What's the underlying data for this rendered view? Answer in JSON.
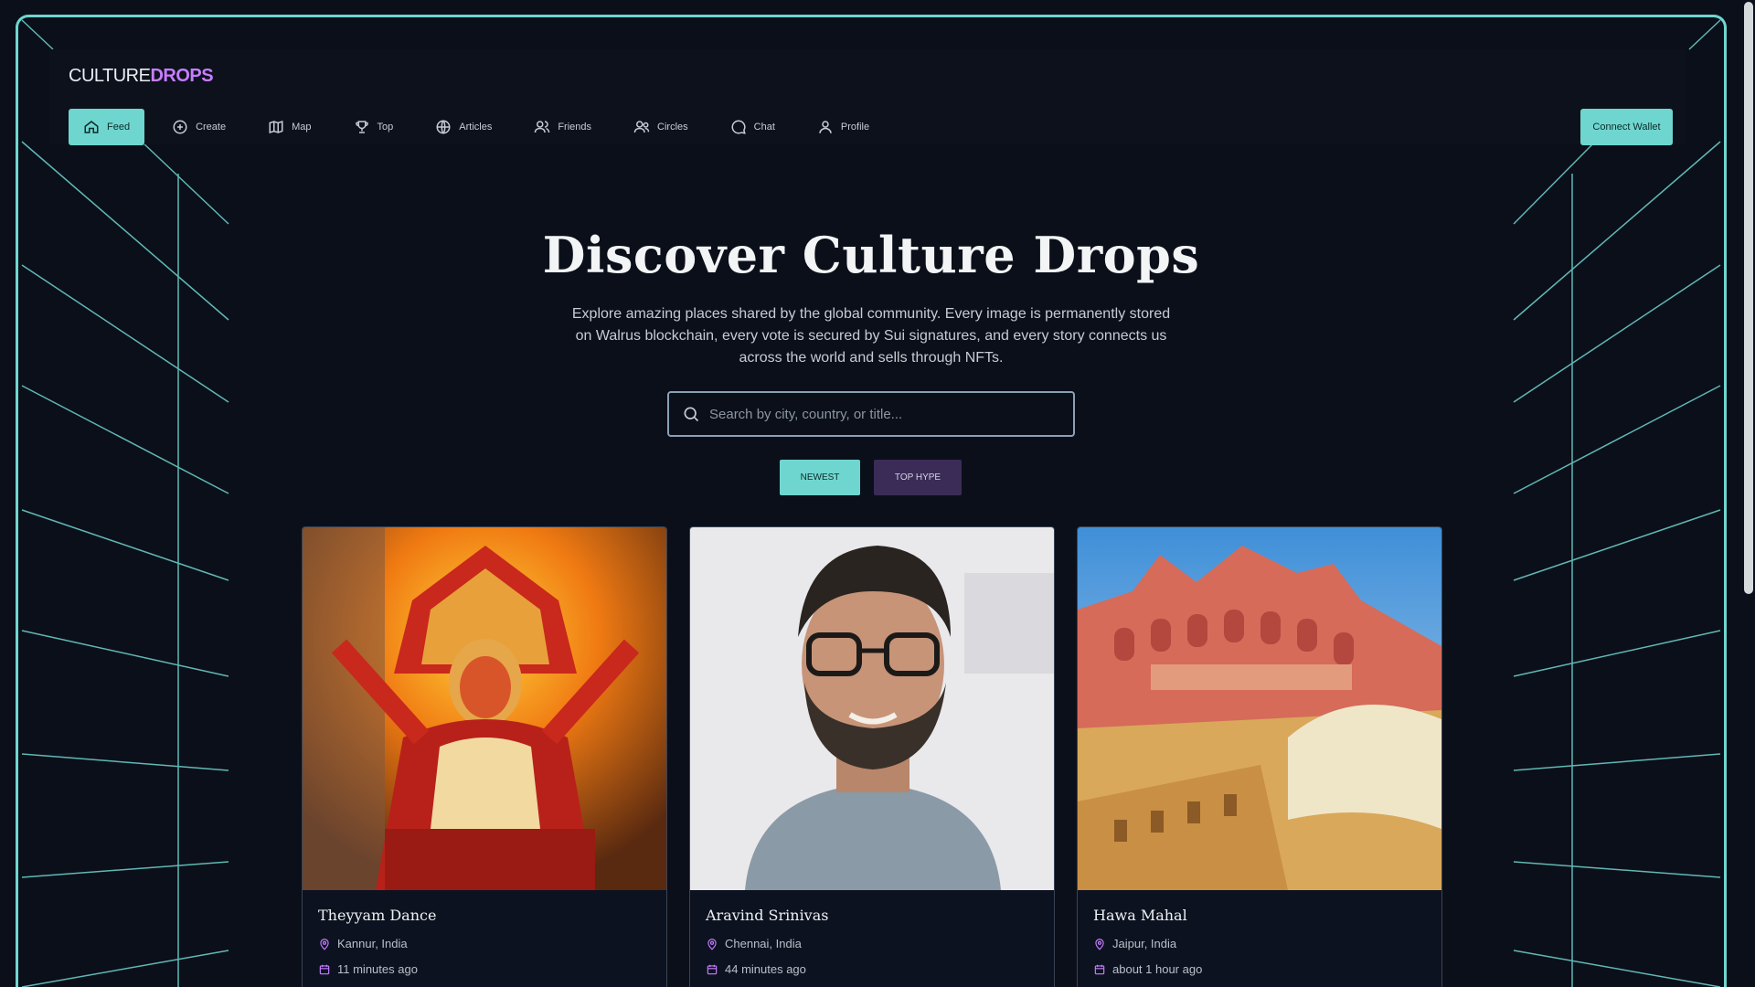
{
  "app": {
    "logo_part1": "CULTURE",
    "logo_part2": "DROPS"
  },
  "nav": {
    "items": [
      {
        "label": "Feed",
        "icon": "home-icon",
        "active": true
      },
      {
        "label": "Create",
        "icon": "plus-circle-icon"
      },
      {
        "label": "Map",
        "icon": "map-icon"
      },
      {
        "label": "Top",
        "icon": "trophy-icon"
      },
      {
        "label": "Articles",
        "icon": "globe-icon"
      },
      {
        "label": "Friends",
        "icon": "users-icon"
      },
      {
        "label": "Circles",
        "icon": "users-group-icon"
      },
      {
        "label": "Chat",
        "icon": "chat-bubble-icon"
      },
      {
        "label": "Profile",
        "icon": "user-icon"
      }
    ],
    "connect_wallet": "Connect Wallet"
  },
  "hero": {
    "title": "Discover Culture Drops",
    "subtitle": "Explore amazing places shared by the global community. Every image is permanently stored on Walrus blockchain, every vote is secured by Sui signatures, and every story connects us across the world and sells through NFTs."
  },
  "search": {
    "placeholder": "Search by city, country, or title..."
  },
  "sort": {
    "newest": "NEWEST",
    "top_hype": "TOP HYPE"
  },
  "cards": [
    {
      "title": "Theyyam Dance",
      "location": "Kannur, India",
      "time": "11 minutes ago",
      "image": "theyyam-dancer-photo"
    },
    {
      "title": "Aravind Srinivas",
      "location": "Chennai, India",
      "time": "44 minutes ago",
      "image": "portrait-photo"
    },
    {
      "title": "Hawa Mahal",
      "location": "Jaipur, India",
      "time": "about 1 hour ago",
      "image": "hawa-mahal-photo"
    }
  ],
  "colors": {
    "accent": "#6fd6cf",
    "brand_purple": "#c77dff",
    "background": "#0b0f1a",
    "hype_button": "#3a2c57"
  }
}
